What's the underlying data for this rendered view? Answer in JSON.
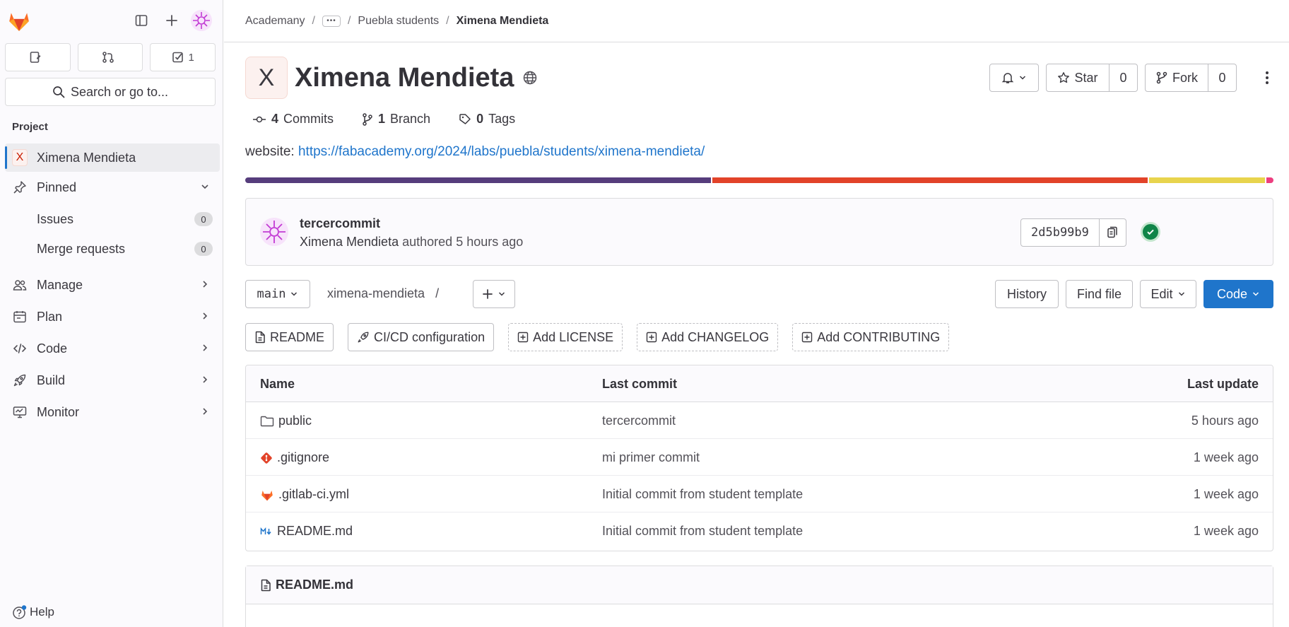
{
  "colors": {
    "accent": "#1f75cb",
    "success": "#108548",
    "lang": [
      "#563d7c",
      "#e24329",
      "#e8d44d",
      "#ed3e7f"
    ]
  },
  "sidebar": {
    "counters": [
      {
        "icon": "issues-icon",
        "value": ""
      },
      {
        "icon": "merge-request-icon",
        "value": ""
      },
      {
        "icon": "todo-icon",
        "value": "1"
      }
    ],
    "search_label": "Search or go to...",
    "section_label": "Project",
    "project_item": {
      "initial": "X",
      "label": "Ximena Mendieta"
    },
    "pinned_label": "Pinned",
    "pinned_items": [
      {
        "label": "Issues",
        "count": "0"
      },
      {
        "label": "Merge requests",
        "count": "0"
      }
    ],
    "nav_items": [
      {
        "label": "Manage",
        "icon": "users-icon"
      },
      {
        "label": "Plan",
        "icon": "planning-icon"
      },
      {
        "label": "Code",
        "icon": "code-icon"
      },
      {
        "label": "Build",
        "icon": "rocket-icon"
      },
      {
        "label": "Monitor",
        "icon": "monitor-icon"
      }
    ],
    "help_label": "Help"
  },
  "breadcrumb": {
    "items": [
      "Academany",
      "Puebla students"
    ],
    "current": "Ximena Mendieta"
  },
  "project": {
    "initial": "X",
    "title": "Ximena Mendieta",
    "notification_icon": "bell-icon",
    "star_label": "Star",
    "star_count": "0",
    "fork_label": "Fork",
    "fork_count": "0"
  },
  "stats": {
    "commits_count": "4",
    "commits_label": "Commits",
    "branch_count": "1",
    "branch_label": "Branch",
    "tags_count": "0",
    "tags_label": "Tags"
  },
  "website": {
    "label": "website:",
    "url": "https://fabacademy.org/2024/labs/puebla/students/ximena-mendieta/"
  },
  "language_bar_fractions": [
    0.455,
    0.425,
    0.113,
    0.007
  ],
  "last_commit": {
    "title": "tercercommit",
    "author": "Ximena Mendieta",
    "authored": "authored",
    "time": "5 hours ago",
    "sha": "2d5b99b9"
  },
  "repo_nav": {
    "branch": "main",
    "path": "ximena-mendieta",
    "path_sep": "/",
    "history": "History",
    "find_file": "Find file",
    "edit": "Edit",
    "code": "Code"
  },
  "shortcuts": [
    {
      "label": "README",
      "dashed": false,
      "icon": "file-icon"
    },
    {
      "label": "CI/CD configuration",
      "dashed": false,
      "icon": "rocket-icon"
    },
    {
      "label": "Add LICENSE",
      "dashed": true,
      "icon": "plus-square-icon"
    },
    {
      "label": "Add CHANGELOG",
      "dashed": true,
      "icon": "plus-square-icon"
    },
    {
      "label": "Add CONTRIBUTING",
      "dashed": true,
      "icon": "plus-square-icon"
    }
  ],
  "file_table": {
    "headers": {
      "name": "Name",
      "commit": "Last commit",
      "date": "Last update"
    },
    "rows": [
      {
        "name": "public",
        "icon": "folder-icon",
        "commit": "tercercommit",
        "date": "5 hours ago"
      },
      {
        "name": ".gitignore",
        "icon": "git-icon",
        "commit": "mi primer commit",
        "date": "1 week ago"
      },
      {
        "name": ".gitlab-ci.yml",
        "icon": "gitlab-icon",
        "commit": "Initial commit from student template",
        "date": "1 week ago"
      },
      {
        "name": "README.md",
        "icon": "markdown-icon",
        "commit": "Initial commit from student template",
        "date": "1 week ago"
      }
    ]
  },
  "readme": {
    "title": "README.md"
  }
}
